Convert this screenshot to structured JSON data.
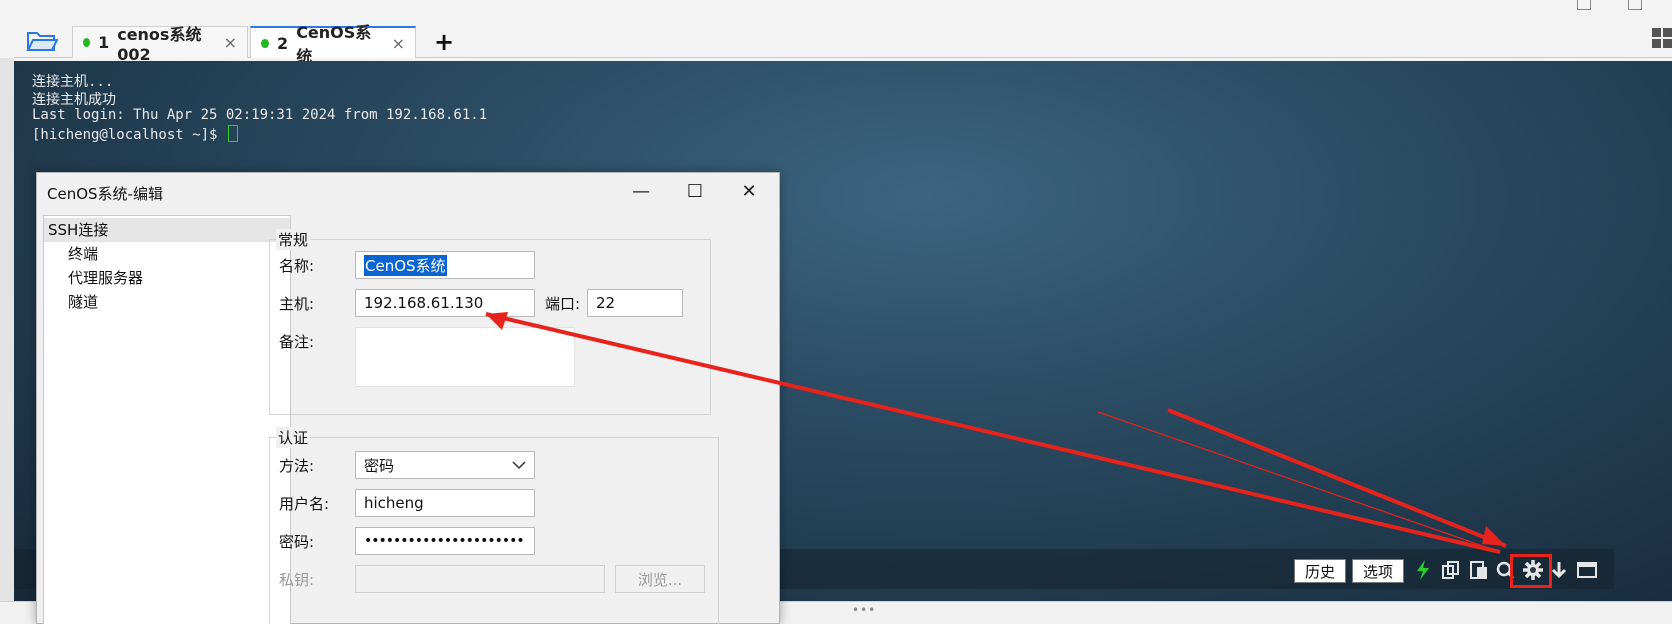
{
  "tabs": [
    {
      "number": "1",
      "label": "cenos系统002",
      "close": "×"
    },
    {
      "number": "2",
      "label": "CenOS系统",
      "close": "×"
    }
  ],
  "add_tab_label": "+",
  "terminal": {
    "lines": [
      "连接主机...",
      "连接主机成功",
      "Last login: Thu Apr 25 02:19:31 2024 from 192.168.61.1"
    ],
    "prompt": "[hicheng@localhost ~]$ "
  },
  "toolbar": {
    "history_label": "历史",
    "options_label": "选项",
    "icons": [
      "lightning-icon",
      "copy-icon",
      "paste-icon",
      "search-icon",
      "gear-icon",
      "download-icon",
      "window-icon"
    ]
  },
  "dialog": {
    "title": "CenOS系统-编辑",
    "minimize": "—",
    "maximize": "☐",
    "close": "✕",
    "tree": {
      "root": "SSH连接",
      "children": [
        "终端",
        "代理服务器",
        "隧道"
      ]
    },
    "general": {
      "title": "常规",
      "name_label": "名称:",
      "name_value": "CenOS系统",
      "host_label": "主机:",
      "host_value": "192.168.61.130",
      "port_label": "端口:",
      "port_value": "22",
      "note_label": "备注:"
    },
    "auth": {
      "title": "认证",
      "method_label": "方法:",
      "method_value": "密码",
      "user_label": "用户名:",
      "user_value": "hicheng",
      "password_label": "密码:",
      "password_value": "••••••••••••••••••••••",
      "key_label": "私钥:",
      "browse_label": "浏览..."
    }
  },
  "colors": {
    "accent": "#2b78e4",
    "annotation": "#e8231b",
    "status_dot": "#1fb81f",
    "selection": "#0a64d2"
  }
}
